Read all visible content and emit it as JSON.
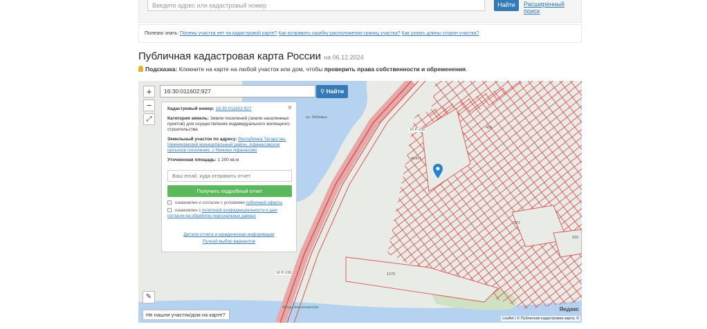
{
  "top_search": {
    "placeholder": "Введите адрес или кадастровый номер",
    "button": "Найти",
    "advanced": "Расширенный поиск"
  },
  "useful": {
    "prefix": "Полезно знать:",
    "link1": "Почему участка нет на кадастровой карте?",
    "link2": "Как исправить ошибку расположения границ участка?",
    "link3": "Как узнать длины сторон участка?"
  },
  "header": {
    "title": "Публичная кадастровая карта России",
    "date": "на 06.12.2024"
  },
  "hint": {
    "label": "Подсказка:",
    "text": "Кликните на карте на любой участок или дом, чтобы",
    "bold": "проверить права собственности и обременения",
    "end": "."
  },
  "map": {
    "zoom_in": "+",
    "zoom_out": "−",
    "search_value": "16:30:011602:927",
    "search_button": "Найти",
    "not_found": "Не нашли участок/дом на карте?",
    "yandex": "Яндекс",
    "attribution": "Leaflet | © Публичная кадастровая карта, ©",
    "labels": {
      "lake": "оз. Лебяжье",
      "l450": "450",
      "l96471": "96471",
      "l327": "327",
      "l326": "326",
      "l1270": "1270",
      "road1": "16 Р-236",
      "road2": "16 Р-236",
      "mill": "Фонд Нижнекамская"
    }
  },
  "popup": {
    "cadastral_label": "Кадастровый номер:",
    "cadastral_value": "16:30:011602:927",
    "category_label": "Категория земель:",
    "category_value": "Земли поселений (земли населенных пунктов) для осуществления индивидуального жилищного строительства",
    "address_label": "Земельный участок по адресу:",
    "address_value": "Республика Татарстан, Нижнекамский муниципальный район, Афанасовское сельское поселение, с Нижнее Афанасово",
    "area_label": "Уточненная площадь:",
    "area_value": "1 200 кв.м",
    "email_placeholder": "Ваш email, куда отправить отчет",
    "get_report": "Получить подробный отчет",
    "check1_text": "ознакомлен и согласен с условиями",
    "check1_link": "публичной оферты",
    "check2_text": "ознакомлен с",
    "check2_link": "политикой конфиденциальности и даю согласие на обработку персональных данных",
    "link_details": "Детали отчета и юридическая информация",
    "link_manual": "Ручной выбор вариантов"
  },
  "colors": {
    "primary": "#337ab7",
    "success": "#5cb85c",
    "parcel": "#d9534f",
    "water": "#b5d3f0"
  }
}
